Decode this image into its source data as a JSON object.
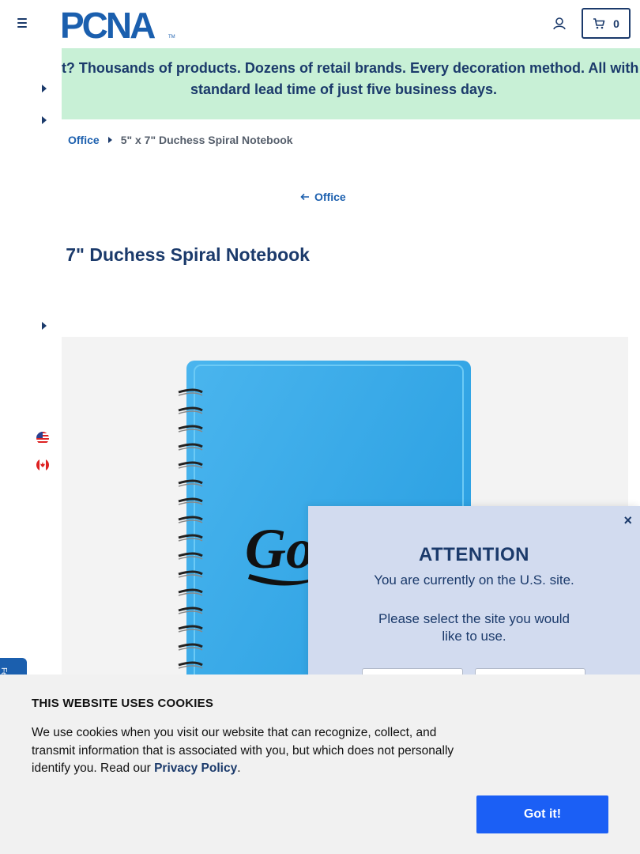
{
  "header": {
    "logo_text": "PCNA",
    "cart_count": "0"
  },
  "banner": {
    "text": "Wait? Thousands of products. Dozens of retail brands. Every decoration method. All with a standard lead time of just five business days."
  },
  "breadcrumb": {
    "items": [
      "Office",
      "5\" x 7\" Duchess Spiral Notebook"
    ]
  },
  "back_link": {
    "label": "Office"
  },
  "product": {
    "title": "5\" x 7\" Duchess Spiral Notebook",
    "cover_color": "#2aa3e6",
    "imprint_text": "Go"
  },
  "region_flags": [
    "us-flag-icon",
    "canada-flag-icon"
  ],
  "modal": {
    "title": "ATTENTION",
    "line1": "You are currently on the U.S. site.",
    "line2": "Please select the site you would like to use.",
    "close": "×"
  },
  "cookie": {
    "title": "THIS WEBSITE USES COOKIES",
    "body_prefix": "We use cookies when you visit our website that can recognize, collect, and transmit information that is associated with you, but which does not personally identify you. Read our ",
    "link": "Privacy Policy",
    "body_suffix": ".",
    "button": "Got it!"
  },
  "feedback": {
    "label": "Feedback"
  },
  "colors": {
    "brand_navy": "#1b3a6b",
    "link_blue": "#1b5fae",
    "banner_green": "#c8f0d6",
    "modal_bg": "#d2dbef",
    "cookie_button": "#1b5ff5"
  }
}
